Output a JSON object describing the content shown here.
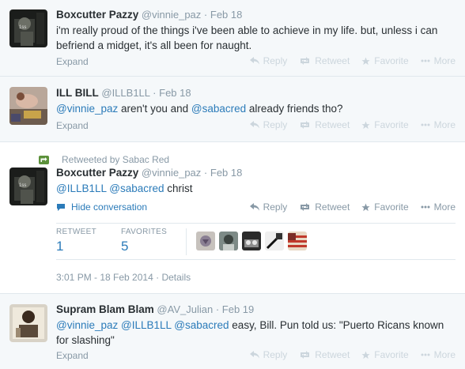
{
  "tweets": [
    {
      "fullname": "Boxcutter Pazzy",
      "username": "@vinnie_paz",
      "date": "Feb 18",
      "text": "i'm really proud of the things i've been able to achieve in my life. but, unless i can befriend a midget, it's all been for naught.",
      "expand": "Expand"
    },
    {
      "fullname": "ILL BILL",
      "username": "@ILLB1LL",
      "date": "Feb 18",
      "mention1": "@vinnie_paz",
      "text_mid": " aren't you and ",
      "mention2": "@sabacred",
      "text_end": " already friends tho?",
      "expand": "Expand"
    },
    {
      "retweeted_by": "Retweeted by Sabac Red",
      "fullname": "Boxcutter Pazzy",
      "username": "@vinnie_paz",
      "date": "Feb 18",
      "mention1": "@ILLB1LL",
      "mention2": "@sabacred",
      "text_end": " christ",
      "hide_conversation": "Hide conversation",
      "retweet_label": "RETWEET",
      "retweet_count": "1",
      "favorites_label": "FAVORITES",
      "favorites_count": "5",
      "timestamp": "3:01 PM - 18 Feb 2014",
      "details": "Details"
    },
    {
      "fullname": "Supram Blam Blam",
      "username": "@AV_Julian",
      "date": "Feb 19",
      "mention1": "@vinnie_paz",
      "mention2": "@ILLB1LL",
      "mention3": "@sabacred",
      "text_end": " easy, Bill. Pun told us: \"Puerto Ricans known for slashing\"",
      "expand": "Expand"
    }
  ],
  "actions": {
    "reply": "Reply",
    "retweet": "Retweet",
    "favorite": "Favorite",
    "more": "More"
  },
  "separator": "·",
  "colors": {
    "link": "#2b7bb9",
    "muted": "#8899a6",
    "faded": "#ccd6dd",
    "retweet_green": "#5c913b"
  }
}
